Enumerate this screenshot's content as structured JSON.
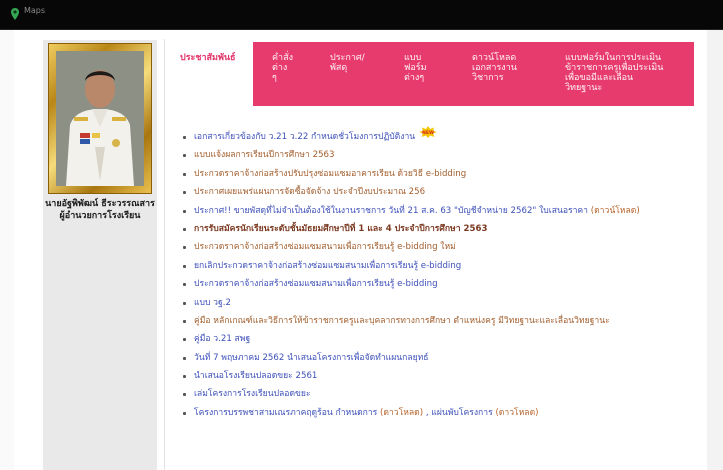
{
  "browser": {
    "bookmark_label": "Maps"
  },
  "sidebar": {
    "caption_name": "นายอัฐพิพัฒน์ ธีระวรรณสาร",
    "caption_role": "ผู้อำนวยการโรงเรียน"
  },
  "tabs": [
    {
      "label": "ประชาสัมพันธ์",
      "active": true
    },
    {
      "label": "คำสั่ง\nต่าง\nๆ",
      "active": false
    },
    {
      "label": "ประกาศ/\nพัสดุ",
      "active": false
    },
    {
      "label": "แบบ\nฟอร์ม\nต่างๆ",
      "active": false
    },
    {
      "label": "ดาวน์โหลด\nเอกสารงาน\nวิชาการ",
      "active": false
    },
    {
      "label": "แบบฟอร์มในการประเมิน\nข้าราชการครูเพื่อประเมิน\nเพื่อขอมีและเลื่อน\nวิทยฐานะ",
      "active": false
    }
  ],
  "colors": {
    "tab_bar": "#e73a6d",
    "link_blue": "#3c4fb8",
    "link_brown": "#a15d2c"
  },
  "announcements": [
    {
      "text": "เอกสารเกี่ยวข้องกับ ว.21  ว.22  กำหนดชั่วโมงการปฏิบัติงาน",
      "style": "blue",
      "badge": "NEW"
    },
    {
      "text": "แบบแจ้งผลการเรียนปีการศึกษา 2563",
      "style": "brown"
    },
    {
      "text": "ประกวดราคาจ้างก่อสร้างปรับปรุงซ่อมแซมอาคารเรียน ด้วยวิธี e-bidding",
      "style": "brown"
    },
    {
      "text": "ประกาศเผยแพร่แผนการจัดซื้อจัดจ้าง ประจำปีงบประมาณ 256",
      "style": "brown"
    },
    {
      "text": "ประกาศ!! ขายพัสดุที่ไม่จำเป็นต้องใช้ในงานราชการ วันที่ 21 ส.ค. 63  \"บัญชีจำหน่าย 2562\" ใบเสนอราคา",
      "style": "blue",
      "link": "(ดาวน์โหลด)"
    },
    {
      "text": "การรับสมัครนักเรียนระดับชั้นมัธยมศึกษาปีที่ 1 และ 4 ประจำปีการศึกษา  2563",
      "style": "bold"
    },
    {
      "text": "ประกวดราคาจ้างก่อสร้างซ่อมแซมสนามเพื่อการเรียนรู้ e-bidding ใหม่",
      "style": "brown"
    },
    {
      "text": "ยกเลิกประกวดราคาจ้างก่อสร้างซ่อมแซมสนามเพื่อการเรียนรู้ e-bidding",
      "style": "blue"
    },
    {
      "text": "ประกวดราคาจ้างก่อสร้างซ่อมแซมสนามเพื่อการเรียนรู้ e-bidding",
      "style": "blue"
    },
    {
      "text": "แบบ วฐ.2",
      "style": "blue"
    },
    {
      "text": "คู่มือ หลักเกณฑ์และวิธีการให้ข้าราชการครูและบุคลากรทางการศึกษา ตำแหน่งครู มีวิทยฐานะและเลื่อนวิทยฐานะ",
      "style": "brown"
    },
    {
      "text": "คู่มือ ว.21 สพฐ",
      "style": "blue"
    },
    {
      "text": "วันที่ 7 พฤษภาคม 2562 นำเสนอโครงการเพื่อจัดทำแผนกลยุทธ์",
      "style": "blue"
    },
    {
      "text": "นำเสนอโรงเรียนปลอดขยะ 2561",
      "style": "blue"
    },
    {
      "text": "เล่มโครงการโรงเรียนปลอดขยะ",
      "style": "blue"
    },
    {
      "text": "โครงการบรรพชาสามเณรภาคฤดูร้อน กำหนดการ",
      "style": "blue",
      "link": "(ดาวโหลด)",
      "text2": " , แผ่นพับโครงการ ",
      "link2": "(ดาวโหลด)"
    }
  ]
}
